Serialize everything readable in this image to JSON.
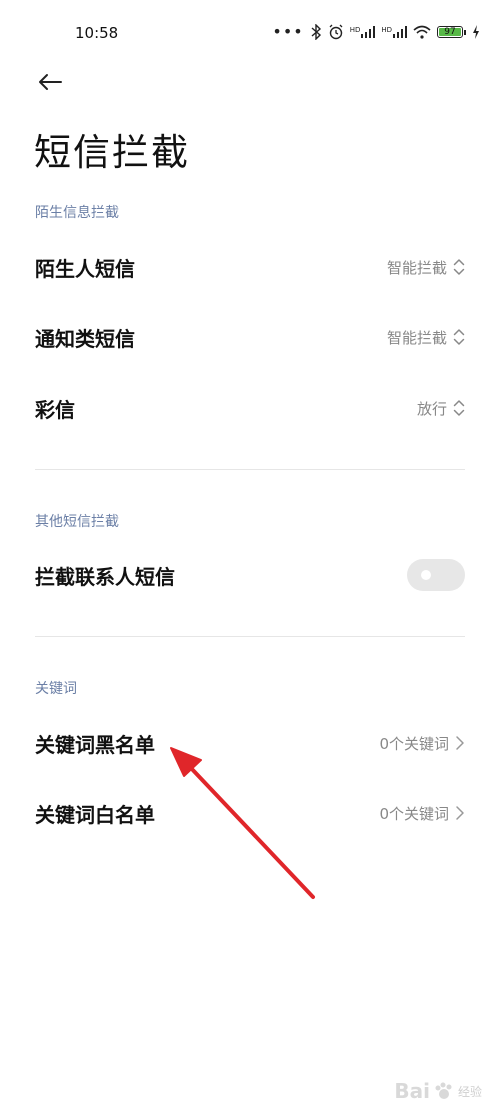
{
  "status_bar": {
    "time": "10:58",
    "dots": "•••",
    "signal1_label": "HD",
    "signal2_label": "HD",
    "battery_level": "97",
    "battery_color": "#57b947"
  },
  "header": {
    "back_icon": "arrow-left-icon",
    "title": "短信拦截"
  },
  "sections": {
    "stranger": {
      "header": "陌生信息拦截",
      "items": [
        {
          "label": "陌生人短信",
          "value": "智能拦截",
          "icon": "unfold-icon"
        },
        {
          "label": "通知类短信",
          "value": "智能拦截",
          "icon": "unfold-icon"
        },
        {
          "label": "彩信",
          "value": "放行",
          "icon": "unfold-icon"
        }
      ]
    },
    "other": {
      "header": "其他短信拦截",
      "items": [
        {
          "label": "拦截联系人短信",
          "toggle_on": false
        }
      ]
    },
    "keywords": {
      "header": "关键词",
      "items": [
        {
          "label": "关键词黑名单",
          "value": "0个关键词",
          "icon": "chevron-right-icon"
        },
        {
          "label": "关键词白名单",
          "value": "0个关键词",
          "icon": "chevron-right-icon"
        }
      ]
    }
  },
  "annotation": {
    "color": "#e0262a",
    "icon": "red-arrow-annotation"
  },
  "watermark": {
    "logo": "Bai",
    "text": "经验"
  }
}
